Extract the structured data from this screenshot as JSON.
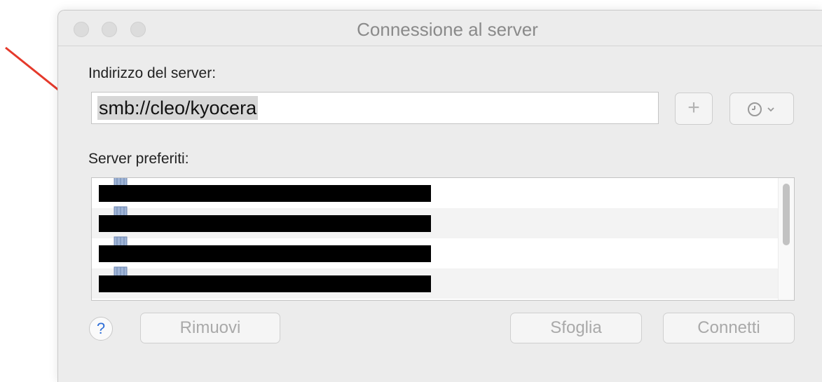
{
  "window": {
    "title": "Connessione al server"
  },
  "server_address": {
    "label": "Indirizzo del server:",
    "value": "smb://cleo/kyocera"
  },
  "toolbar": {
    "add_label": "+",
    "history_icon": "clock-icon"
  },
  "favorites": {
    "label": "Server preferiti:",
    "items": [
      {
        "text": "",
        "redacted": true
      },
      {
        "text": "",
        "redacted": true
      },
      {
        "text": "",
        "redacted": true
      },
      {
        "text": "",
        "redacted": true
      }
    ]
  },
  "buttons": {
    "help": "?",
    "remove": "Rimuovi",
    "browse": "Sfoglia",
    "connect": "Connetti"
  },
  "annotation": {
    "arrow_color": "#e5392b"
  }
}
